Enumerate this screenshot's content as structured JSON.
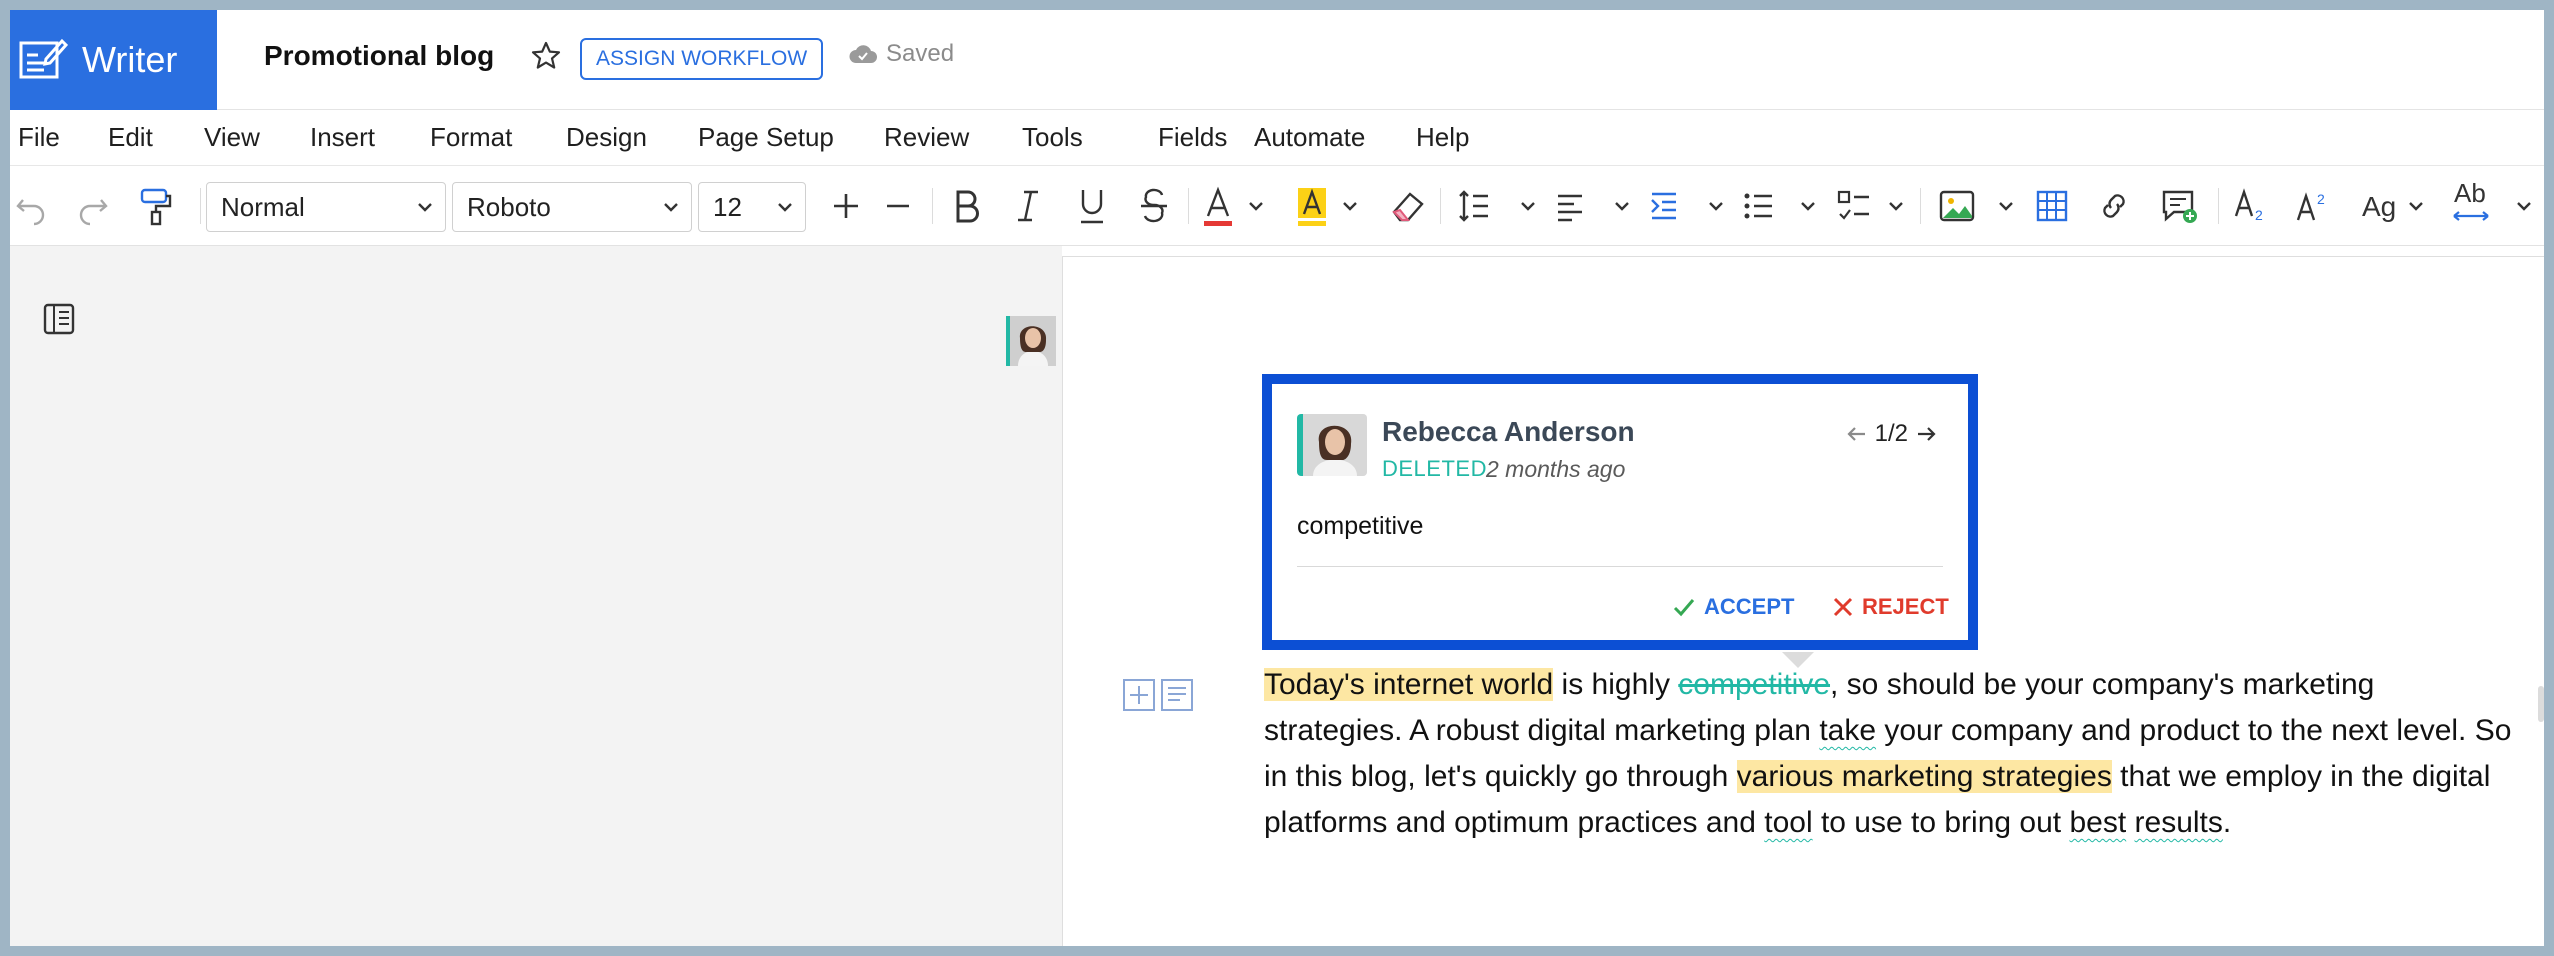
{
  "app": {
    "name": "Writer",
    "doc_title": "Promotional blog",
    "workflow_label": "ASSIGN WORKFLOW",
    "save_status": "Saved"
  },
  "menu": [
    "File",
    "Edit",
    "View",
    "Insert",
    "Format",
    "Design",
    "Page Setup",
    "Review",
    "Tools",
    "Fields",
    "Automate",
    "Help"
  ],
  "toolbar": {
    "style": "Normal",
    "font": "Roboto",
    "size": "12",
    "font_color": "#e53935",
    "highlight_color": "#fcd116"
  },
  "comment": {
    "author": "Rebecca Anderson",
    "status": "DELETED",
    "time": "2 months ago",
    "position": "1/2",
    "content": "competitive",
    "accept_label": "ACCEPT",
    "reject_label": "REJECT",
    "accent": "#22b8a5",
    "border": "#0c4fd4"
  },
  "document": {
    "p1": "Today's internet world",
    "p2": " is highly ",
    "p3": "competitive",
    "p4": ", so should be your company's marketing strategies. A robust digital marketing plan ",
    "p5": "take",
    "p6": " your company and product to the next level. So in this blog, let's quickly go through ",
    "p7": "various marketing strategies",
    "p8": " that we employ in the digital platforms and optimum practices and ",
    "p9": "tool",
    "p10": " to use to bring out ",
    "p11": "best",
    "p12": " ",
    "p13": "results",
    "p14": "."
  }
}
